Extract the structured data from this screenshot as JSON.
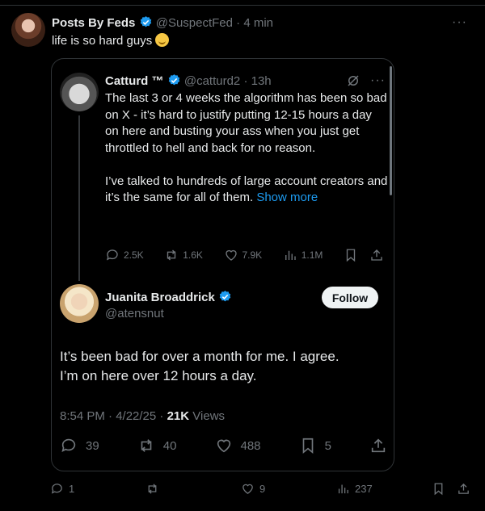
{
  "post": {
    "author_name": "Posts By Feds",
    "handle": "@SuspectFed",
    "time": "· 4 min",
    "text": "life is so hard guys",
    "emoji": "pensive-face",
    "stats": {
      "replies": "1",
      "reposts": "",
      "likes": "9",
      "views": "237"
    }
  },
  "quote": {
    "author_name": "Catturd ™",
    "handle": "@catturd2",
    "time": "· 13h",
    "paragraph1": "The last 3 or 4 weeks the algorithm has been so bad on X - it’s hard to justify putting 12-15 hours a day on here and busting your ass when you just get throttled to hell and back for no reason.",
    "paragraph2": "I’ve talked to hundreds of large account creators and it’s the same for all of them.",
    "show_more": "Show more",
    "stats": {
      "replies": "2.5K",
      "reposts": "1.6K",
      "likes": "7.9K",
      "views": "1.1M"
    }
  },
  "reply": {
    "author_name": "Juanita Broaddrick",
    "handle": "@atensnut",
    "follow_label": "Follow",
    "text_line1": "It’s been bad for over a month for me.  I agree.",
    "text_line2": "I’m on here over 12 hours a day.",
    "timestamp": "8:54 PM · 4/22/25 ·",
    "views_count": "21K",
    "views_label": "Views",
    "stats": {
      "replies": "39",
      "reposts": "40",
      "likes": "488",
      "bookmarks": "5"
    }
  },
  "colors": {
    "accent": "#1d9bf0",
    "verified": "#1d9bf0",
    "background": "#000000",
    "muted": "#71767b"
  }
}
